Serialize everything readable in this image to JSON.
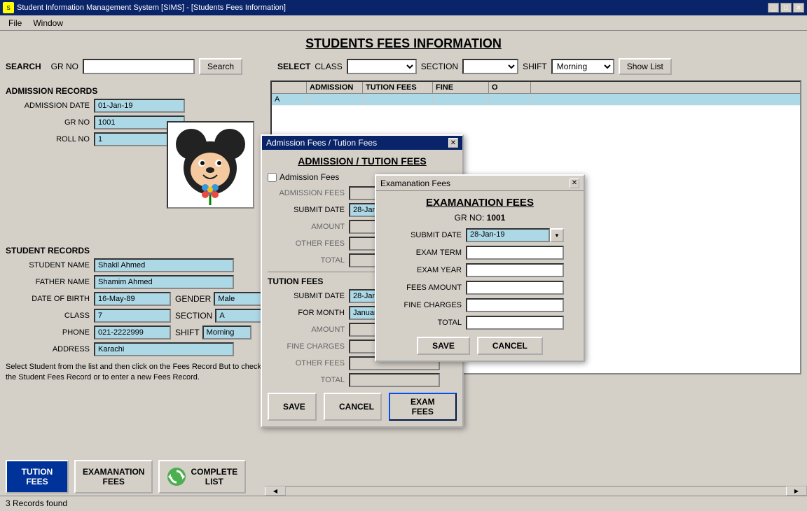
{
  "titleBar": {
    "text": "Student Information Management System [SIMS] - [Students Fees Information]",
    "icon": "SIMS"
  },
  "menuBar": {
    "items": [
      "File",
      "Window"
    ]
  },
  "pageTitle": "STUDENTS FEES INFORMATION",
  "search": {
    "label": "SEARCH",
    "grLabel": "GR NO",
    "btnLabel": "Search",
    "placeholder": ""
  },
  "select": {
    "label": "SELECT",
    "classLabel": "CLASS",
    "sectionLabel": "SECTION",
    "shiftLabel": "SHIFT",
    "shiftValue": "Morning",
    "showListLabel": "Show List"
  },
  "admissionRecords": {
    "header": "ADMISSION RECORDS",
    "fields": [
      {
        "label": "ADMISSION DATE",
        "value": "01-Jan-19"
      },
      {
        "label": "GR NO",
        "value": "1001"
      },
      {
        "label": "ROLL NO",
        "value": "1"
      }
    ]
  },
  "studentRecords": {
    "header": "STUDENT RECORDS",
    "fields": [
      {
        "label": "STUDENT NAME",
        "value": "Shakil Ahmed"
      },
      {
        "label": "FATHER NAME",
        "value": "Shamim Ahmed"
      },
      {
        "label": "DATE OF BIRTH",
        "value": "16-May-89"
      },
      {
        "label": "GENDER",
        "value": "Male"
      },
      {
        "label": "CLASS",
        "value": "7"
      },
      {
        "label": "SECTION",
        "value": "A"
      },
      {
        "label": "PHONE",
        "value": "021-2222999"
      },
      {
        "label": "SHIFT",
        "value": "Morning"
      },
      {
        "label": "ADDRESS",
        "value": "Karachi"
      }
    ]
  },
  "infoText": "Select Student from the list and then click on the Fees Record But to check the Student Fees Record or to enter a new Fees Record.",
  "bottomButtons": [
    {
      "label": "TUTION\nFEES",
      "active": true
    },
    {
      "label": "EXAMANATION\nFEES",
      "active": false
    },
    {
      "label": "COMPLETE\nLIST",
      "active": false,
      "hasIcon": true
    }
  ],
  "statusBar": {
    "text": "3 Records found"
  },
  "gridHeaders": [
    "",
    "ADMISSION",
    "TUTION FEES",
    "FINE",
    "O"
  ],
  "gridRows": [
    [
      "A",
      "",
      "",
      "",
      ""
    ]
  ],
  "dialog1": {
    "title": "Admission Fees / Tution Fees",
    "sectionTitle": "ADMISSION / TUTION FEES",
    "checkboxLabel": "Admission Fees",
    "labels": {
      "admissionFees": "ADMISSION FEES",
      "submitDate": "SUBMIT DATE",
      "amount": "AMOUNT",
      "otherFees": "OTHER FEES",
      "total": "TOTAL",
      "tutionFees": "TUTION FEES",
      "submitDate2": "SUBMIT DATE",
      "forMonth": "FOR MONTH",
      "amount2": "AMOUNT",
      "fineFees": "FINE CHARGES",
      "otherFees2": "OTHER FEES",
      "total2": "TOTAL"
    },
    "values": {
      "submitDate": "28-Jan-19",
      "submitDate2": "28-Jan-19",
      "forMonth": "January"
    },
    "buttons": {
      "save": "SAVE",
      "cancel": "CANCEL",
      "examFees": "EXAM FEES"
    }
  },
  "dialog2": {
    "titleBarText": "Examanation Fees",
    "title": "EXAMANATION FEES",
    "grNo": "1001",
    "grLabel": "GR NO:",
    "labels": {
      "submitDate": "SUBMIT DATE",
      "examTerm": "EXAM TERM",
      "examYear": "EXAM YEAR",
      "feesAmount": "FEES AMOUNT",
      "fineCharges": "FINE CHARGES",
      "total": "TOTAL"
    },
    "values": {
      "submitDate": "28-Jan-19"
    },
    "buttons": {
      "save": "SAVE",
      "cancel": "CANCEL"
    }
  }
}
